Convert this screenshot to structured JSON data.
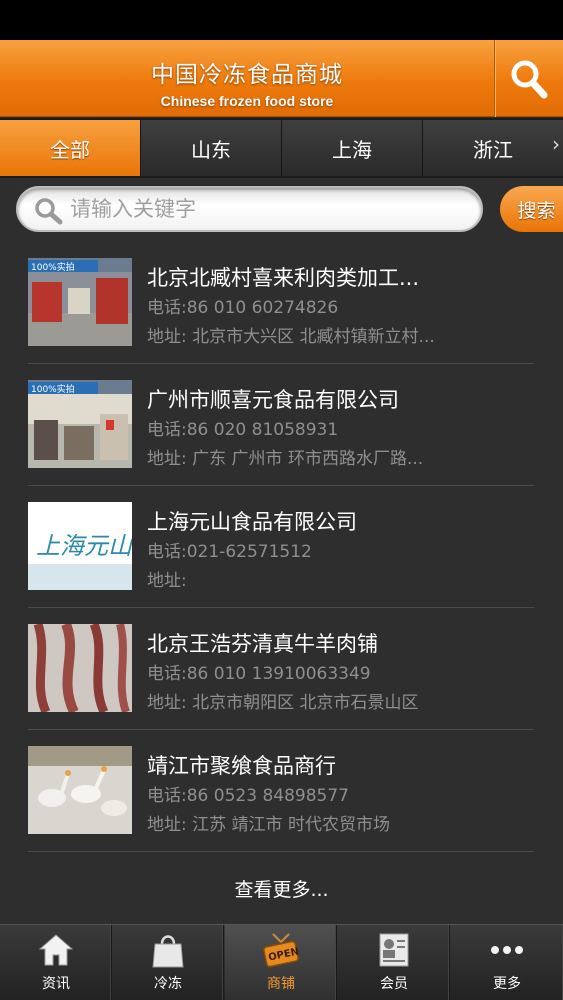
{
  "header": {
    "title_cn": "中国冷冻食品商城",
    "title_en": "Chinese frozen food store",
    "search_icon": "search-icon"
  },
  "tabs": [
    {
      "label": "全部",
      "active": true
    },
    {
      "label": "山东",
      "active": false
    },
    {
      "label": "上海",
      "active": false
    },
    {
      "label": "浙江",
      "active": false
    }
  ],
  "search": {
    "placeholder": "请输入关键字",
    "button_label": "搜索"
  },
  "list": {
    "phone_label": "电话:",
    "addr_label": "地址:",
    "photo_badge": "100%实拍",
    "items": [
      {
        "name": "北京北臧村喜来利肉类加工...",
        "phone": "86 010 60274826",
        "address": "北京市大兴区 北臧村镇新立村..."
      },
      {
        "name": "广州市顺喜元食品有限公司",
        "phone": "86 020 81058931",
        "address": "广东 广州市 环市西路水厂路..."
      },
      {
        "name": "上海元山食品有限公司",
        "phone": "021-62571512",
        "address": "",
        "thumb_text": "上海元山"
      },
      {
        "name": "北京王浩芬清真牛羊肉铺",
        "phone": "86 010 13910063349",
        "address": "北京市朝阳区 北京市石景山区"
      },
      {
        "name": "靖江市聚飨食品商行",
        "phone": "86 0523 84898577",
        "address": "江苏 靖江市 时代农贸市场"
      }
    ]
  },
  "more_label": "查看更多...",
  "bottom_nav": [
    {
      "label": "资讯",
      "icon": "home-icon",
      "active": false
    },
    {
      "label": "冷冻",
      "icon": "shopping-bag-icon",
      "active": false
    },
    {
      "label": "商铺",
      "icon": "open-sign-icon",
      "active": true,
      "icon_text": "OPEN"
    },
    {
      "label": "会员",
      "icon": "member-card-icon",
      "active": false
    },
    {
      "label": "更多",
      "icon": "more-dots-icon",
      "active": false
    }
  ],
  "colors": {
    "accent": "#ee7a0c",
    "background": "#2e2e2e",
    "secondary_text": "#8f8f8f"
  }
}
